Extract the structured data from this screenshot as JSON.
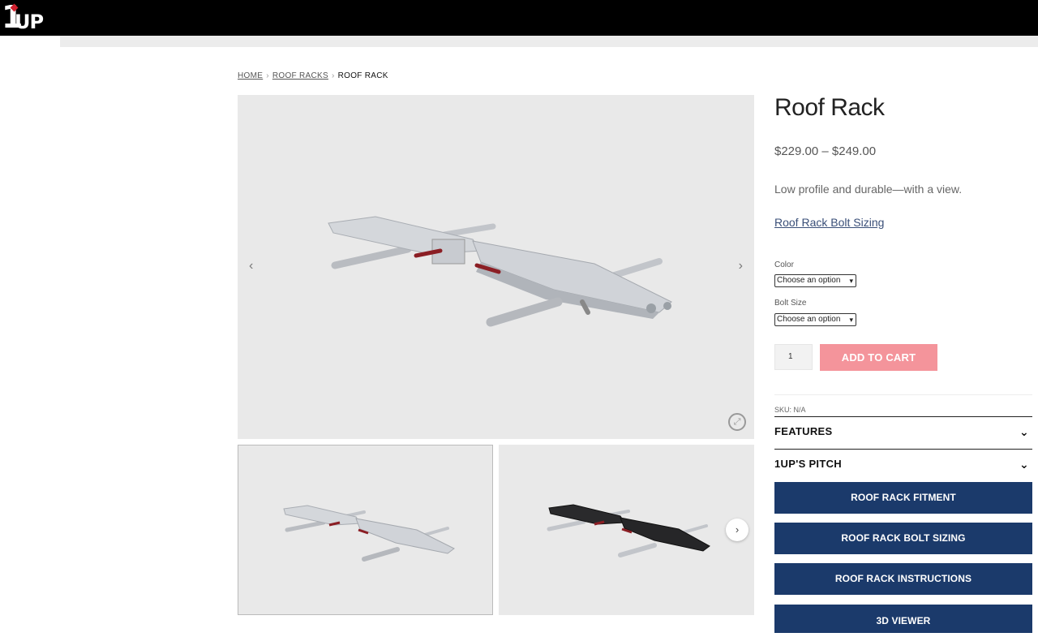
{
  "header": {
    "logo_text_one": "1",
    "logo_text_up": "UP"
  },
  "breadcrumb": {
    "home": "HOME",
    "roof_racks": "ROOF RACKS",
    "current": "ROOF RACK",
    "separator": "›"
  },
  "gallery": {
    "prev_icon": "‹",
    "next_icon": "›",
    "zoom_icon": "⤢"
  },
  "product": {
    "title": "Roof Rack",
    "price": "$229.00 – $249.00",
    "tagline": "Low profile and durable—with a view.",
    "sizing_link": "Roof Rack Bolt Sizing",
    "color_label": "Color",
    "color_value": "Choose an option",
    "bolt_label": "Bolt Size",
    "bolt_value": "Choose an option",
    "quantity": "1",
    "add_to_cart": "ADD TO CART",
    "sku": "SKU: N/A"
  },
  "accordions": [
    {
      "label": "FEATURES"
    },
    {
      "label": "1UP'S PITCH"
    }
  ],
  "buttons": [
    {
      "label": "ROOF RACK FITMENT"
    },
    {
      "label": "ROOF RACK BOLT SIZING"
    },
    {
      "label": "ROOF RACK INSTRUCTIONS"
    },
    {
      "label": "3D VIEWER"
    }
  ],
  "colors": {
    "add_to_cart": "#f4949b",
    "nav_button": "#1b3a6b",
    "link": "#3a4f78"
  }
}
